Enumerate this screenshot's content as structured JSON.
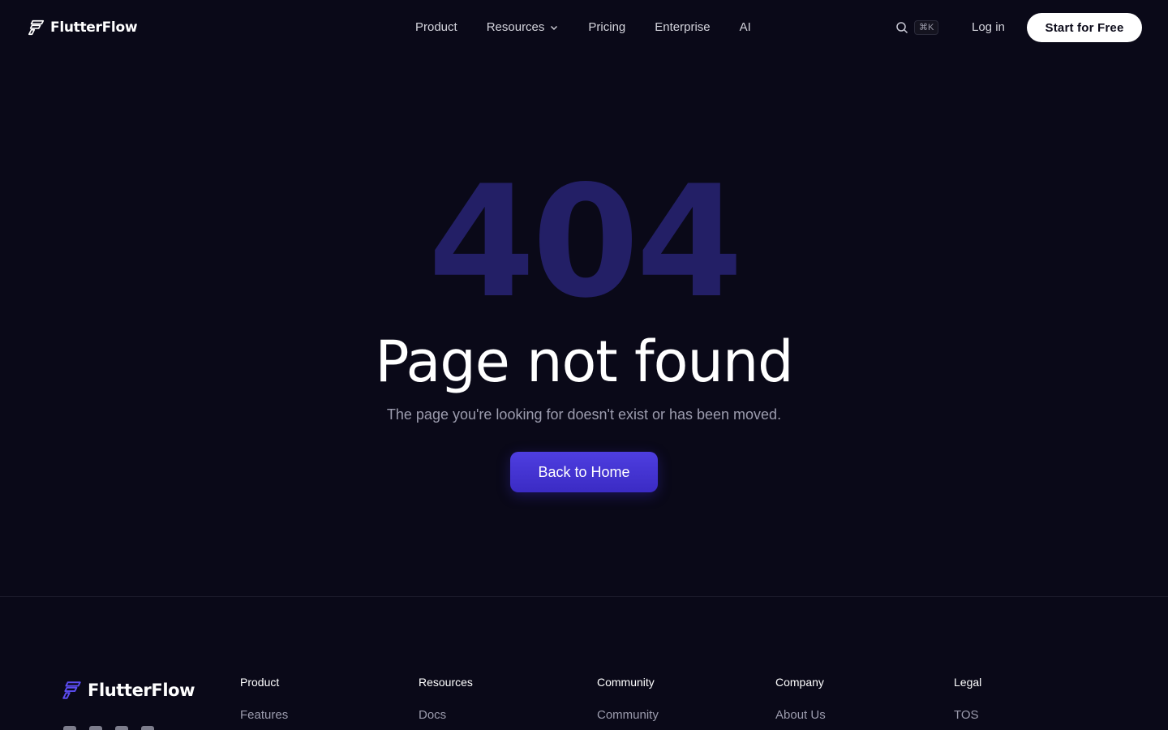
{
  "brand": {
    "name": "FlutterFlow",
    "accent": "#3b2bc4"
  },
  "nav": {
    "links": [
      {
        "label": "Product"
      },
      {
        "label": "Resources",
        "has_dropdown": true
      },
      {
        "label": "Pricing"
      },
      {
        "label": "Enterprise"
      },
      {
        "label": "AI"
      }
    ],
    "search_icon": "search-icon",
    "shortcut": "⌘K",
    "login_label": "Log in",
    "cta_label": "Start for Free"
  },
  "hero": {
    "code": "404",
    "title": "Page not found",
    "subtitle": "The page you're looking for doesn't exist or has been moved.",
    "button_label": "Back to Home"
  },
  "footer": {
    "brand": "FlutterFlow",
    "columns": [
      {
        "heading": "Product",
        "items": [
          "Features"
        ]
      },
      {
        "heading": "Resources",
        "items": [
          "Docs"
        ]
      },
      {
        "heading": "Community",
        "items": [
          "Community"
        ]
      },
      {
        "heading": "Company",
        "items": [
          "About Us"
        ]
      },
      {
        "heading": "Legal",
        "items": [
          "TOS"
        ]
      }
    ]
  }
}
